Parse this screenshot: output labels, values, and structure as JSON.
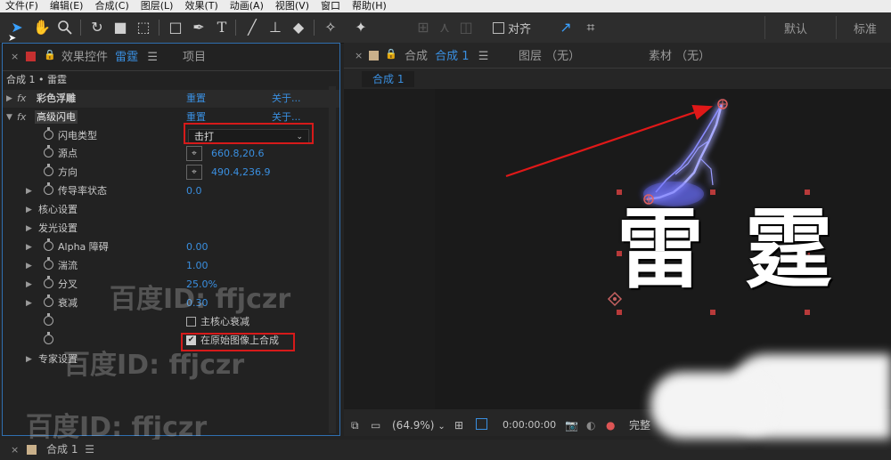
{
  "menubar": [
    "文件(F)",
    "编辑(E)",
    "合成(C)",
    "图层(L)",
    "效果(T)",
    "动画(A)",
    "视图(V)",
    "窗口",
    "帮助(H)"
  ],
  "toolbar": {
    "align_label": "对齐",
    "workspace_default": "默认",
    "workspace_standard": "标准"
  },
  "left_panel": {
    "tab_effects": "效果控件",
    "tab_effects_target": "雷霆",
    "tab_project": "项目",
    "breadcrumb": "合成 1 • 雷霆",
    "effects": [
      {
        "name": "彩色浮雕",
        "reset": "重置",
        "about": "关于..."
      },
      {
        "name": "高级闪电",
        "reset": "重置",
        "about": "关于..."
      }
    ],
    "params": {
      "lightning_type": {
        "label": "闪电类型",
        "value": "击打"
      },
      "origin": {
        "label": "源点",
        "value": "660.8,20.6"
      },
      "direction": {
        "label": "方向",
        "value": "490.4,236.9"
      },
      "conductivity": {
        "label": "传导率状态",
        "value": "0.0"
      },
      "core_settings": {
        "label": "核心设置"
      },
      "glow_settings": {
        "label": "发光设置"
      },
      "alpha_obstacle": {
        "label": "Alpha 障碍",
        "value": "0.00"
      },
      "turbulence": {
        "label": "湍流",
        "value": "1.00"
      },
      "forking": {
        "label": "分叉",
        "value": "25.0%"
      },
      "decay": {
        "label": "衰减",
        "value": "0.30"
      },
      "main_core_decay": {
        "label": "主核心衰减",
        "checked": false
      },
      "composite_original": {
        "label": "在原始图像上合成",
        "checked": true
      },
      "expert_settings": {
        "label": "专家设置"
      }
    },
    "watermark": "百度ID: ffjczr"
  },
  "right_panel": {
    "tab_comp_prefix": "合成",
    "tab_comp_name": "合成 1",
    "tab_layer": "图层 （无）",
    "tab_footage": "素材 （无）",
    "comp_chip": "合成 1",
    "title_text": "雷 霆"
  },
  "viewbar": {
    "zoom": "(64.9%)",
    "timecode": "0:00:00:00",
    "quality": "完整"
  },
  "timeline": {
    "tab": "合成 1"
  },
  "colors": {
    "accent": "#3a8fe0",
    "highlight_red": "#d61a1a",
    "lightning": "#8a8cff"
  }
}
